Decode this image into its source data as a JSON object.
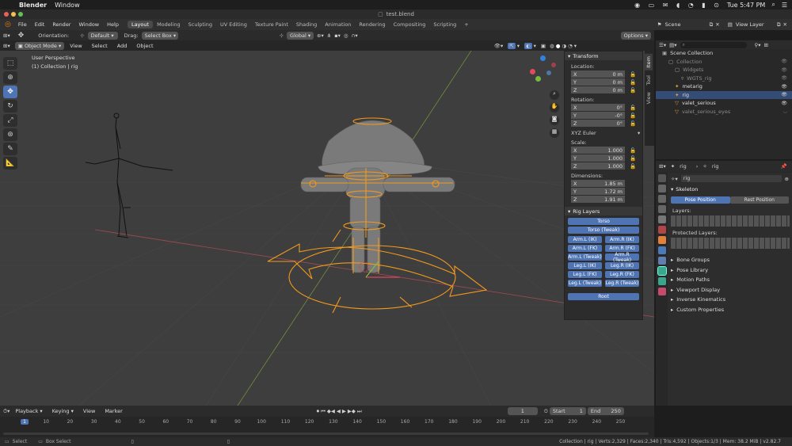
{
  "macos": {
    "app": "Blender",
    "menu": [
      "Window"
    ],
    "clock": "Tue 5:47 PM"
  },
  "window": {
    "title": "test.blend"
  },
  "menubar": {
    "menus": [
      "File",
      "Edit",
      "Render",
      "Window",
      "Help"
    ],
    "workspaces": [
      "Layout",
      "Modeling",
      "Sculpting",
      "UV Editing",
      "Texture Paint",
      "Shading",
      "Animation",
      "Rendering",
      "Compositing",
      "Scripting"
    ],
    "active_workspace": "Layout",
    "add_workspace": "+",
    "scene": "Scene",
    "view_layer": "View Layer"
  },
  "tool_header": {
    "orientation_label": "Orientation:",
    "orientation_value": "Default",
    "drag_label": "Drag:",
    "drag_value": "Select Box",
    "transform_orientation": "Global",
    "options": "Options"
  },
  "viewport_header": {
    "mode": "Object Mode",
    "menus": [
      "View",
      "Select",
      "Add",
      "Object"
    ]
  },
  "viewport": {
    "view_name": "User Perspective",
    "context": "(1) Collection | rig"
  },
  "npanel": {
    "tabs": [
      "Item",
      "Tool",
      "View"
    ],
    "transform_title": "Transform",
    "location_label": "Location:",
    "location": [
      {
        "axis": "X",
        "value": "0 m"
      },
      {
        "axis": "Y",
        "value": "0 m"
      },
      {
        "axis": "Z",
        "value": "0 m"
      }
    ],
    "rotation_label": "Rotation:",
    "rotation": [
      {
        "axis": "X",
        "value": "0°"
      },
      {
        "axis": "Y",
        "value": "-0°"
      },
      {
        "axis": "Z",
        "value": "0°"
      }
    ],
    "rotation_mode": "XYZ Euler",
    "scale_label": "Scale:",
    "scale": [
      {
        "axis": "X",
        "value": "1.000"
      },
      {
        "axis": "Y",
        "value": "1.000"
      },
      {
        "axis": "Z",
        "value": "1.000"
      }
    ],
    "dimensions_label": "Dimensions:",
    "dimensions": [
      {
        "axis": "X",
        "value": "1.85 m"
      },
      {
        "axis": "Y",
        "value": "1.72 m"
      },
      {
        "axis": "Z",
        "value": "1.91 m"
      }
    ],
    "rig_layers_title": "Rig Layers",
    "rig_layers": {
      "torso": "Torso",
      "torso_tweak": "Torso (Tweak)",
      "pairs": [
        [
          "Arm.L (IK)",
          "Arm.R (IK)"
        ],
        [
          "Arm.L (FK)",
          "Arm.R (FK)"
        ],
        [
          "Arm.L (Tweak)",
          "Arm.R (Tweak)"
        ],
        [
          "Leg.L (IK)",
          "Leg.R (IK)"
        ],
        [
          "Leg.L (FK)",
          "Leg.R (FK)"
        ],
        [
          "Leg.L (Tweak)",
          "Leg.R (Tweak)"
        ]
      ],
      "root": "Root"
    }
  },
  "outliner": {
    "items": [
      {
        "name": "Scene Collection",
        "indent": 0,
        "selected": false,
        "dim": false
      },
      {
        "name": "Collection",
        "indent": 1,
        "selected": false,
        "dim": true
      },
      {
        "name": "Widgets",
        "indent": 2,
        "selected": false,
        "dim": true
      },
      {
        "name": "WGTS_rig",
        "indent": 3,
        "selected": false,
        "dim": true
      },
      {
        "name": "metarig",
        "indent": 2,
        "selected": false,
        "dim": false
      },
      {
        "name": "rig",
        "indent": 2,
        "selected": true,
        "dim": false
      },
      {
        "name": "valet_serious",
        "indent": 2,
        "selected": false,
        "dim": false
      },
      {
        "name": "valet_serious_eyes",
        "indent": 2,
        "selected": false,
        "dim": true
      }
    ]
  },
  "properties": {
    "breadcrumb_object": "rig",
    "breadcrumb_data": "rig",
    "data_name": "rig",
    "skeleton_title": "Skeleton",
    "pose_position": "Pose Position",
    "rest_position": "Rest Position",
    "layers_label": "Layers:",
    "protected_layers_label": "Protected Layers:",
    "panels": [
      "Bone Groups",
      "Pose Library",
      "Motion Paths",
      "Viewport Display",
      "Inverse Kinematics",
      "Custom Properties"
    ]
  },
  "timeline": {
    "menus": [
      "Playback",
      "Keying",
      "View",
      "Marker"
    ],
    "current_frame": "1",
    "start_label": "Start",
    "start": "1",
    "end_label": "End",
    "end": "250",
    "ruler": [
      "1",
      "10",
      "20",
      "30",
      "40",
      "50",
      "60",
      "70",
      "80",
      "90",
      "100",
      "110",
      "120",
      "130",
      "140",
      "150",
      "160",
      "170",
      "180",
      "190",
      "200",
      "210",
      "220",
      "230",
      "240",
      "250"
    ]
  },
  "statusbar": {
    "select": "Select",
    "box_select": "Box Select",
    "stats": "Collection | rig | Verts:2,329 | Faces:2,340 | Tris:4,592 | Objects:1/3 | Mem: 38.2 MiB | v2.82.7"
  },
  "colors": {
    "accent": "#4f74b4",
    "rig_orange": "#f39a1c",
    "selection_row": "#344d77"
  }
}
